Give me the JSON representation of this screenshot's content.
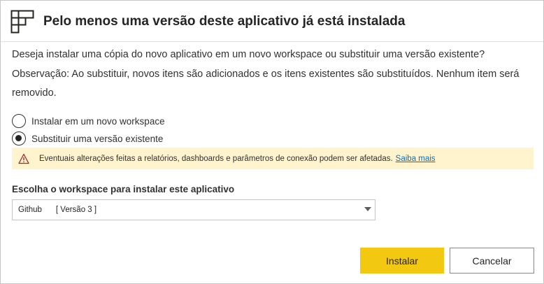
{
  "dialog": {
    "title": "Pelo menos uma versão deste aplicativo já está instalada",
    "icon": "app-grid-icon",
    "description": "Deseja instalar uma cópia do novo aplicativo em um novo workspace ou substituir uma versão existente? Observação: Ao substituir, novos itens são adicionados e os itens existentes são substituídos. Nenhum item será removido."
  },
  "options": [
    {
      "label": "Instalar em um novo workspace",
      "selected": false
    },
    {
      "label": "Substituir uma versão existente",
      "selected": true
    }
  ],
  "warning": {
    "icon": "warning-icon",
    "text": "Eventuais alterações feitas a relatórios, dashboards e parâmetros de conexão podem ser afetadas.",
    "link": "Saiba mais",
    "background": "#fff4ce",
    "icon_color": "#a4262c"
  },
  "workspace": {
    "label": "Escolha o workspace para instalar este aplicativo",
    "selected_name": "Github",
    "selected_version": "[ Versão 3 ]"
  },
  "buttons": {
    "install": "Instalar",
    "cancel": "Cancelar",
    "primary_color": "#f2c811"
  }
}
